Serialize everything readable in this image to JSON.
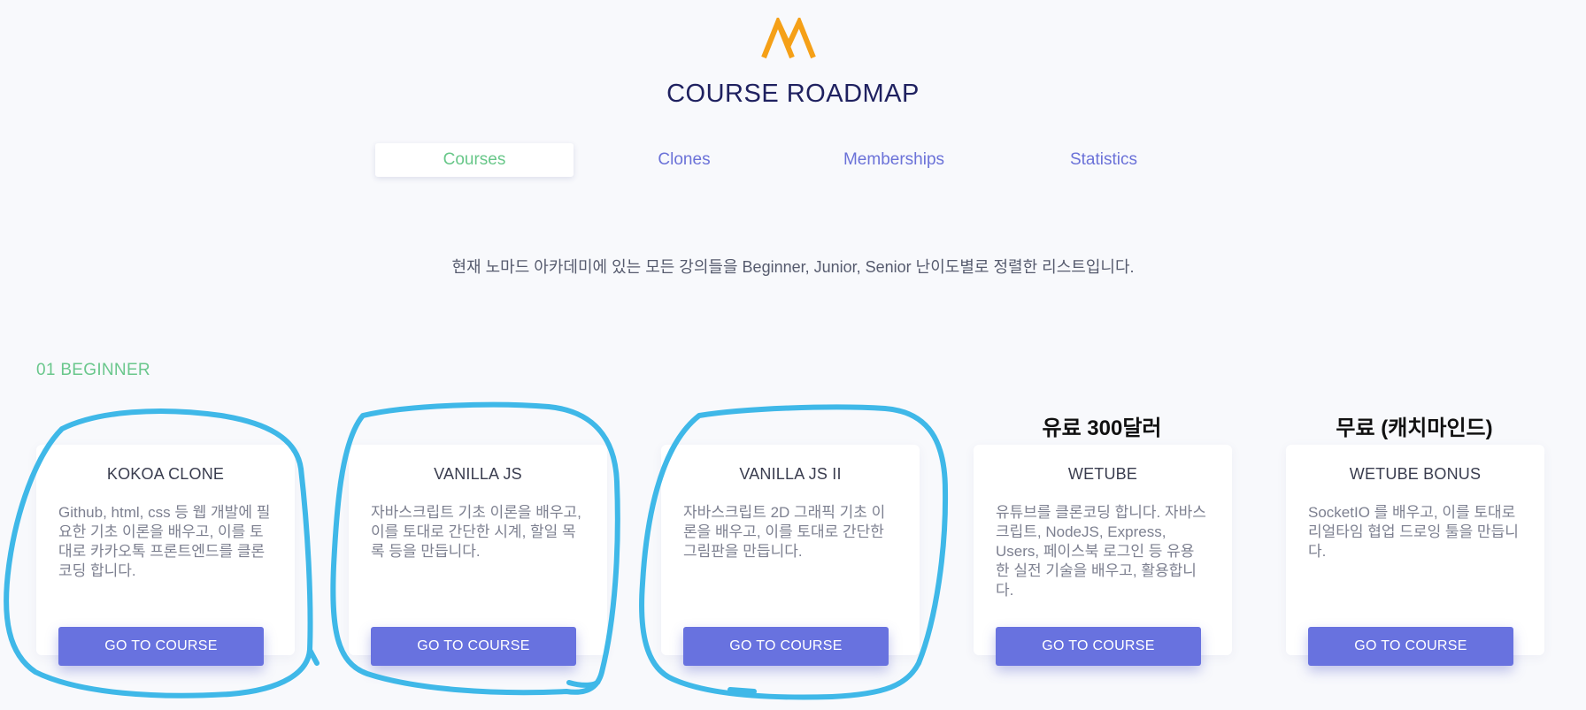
{
  "header": {
    "title": "COURSE ROADMAP",
    "logo_icon": "nomad-coders-logo-icon",
    "logo_color": "#f5a017"
  },
  "tabs": [
    {
      "label": "Courses",
      "active": true
    },
    {
      "label": "Clones",
      "active": false
    },
    {
      "label": "Memberships",
      "active": false
    },
    {
      "label": "Statistics",
      "active": false
    }
  ],
  "intro": "현재 노마드 아카데미에 있는 모든 강의들을 Beginner, Junior, Senior 난이도별로 정렬한 리스트입니다.",
  "section": {
    "label": "01 BEGINNER"
  },
  "annotations": {
    "wetube_note": "유료 300달러",
    "wetube_bonus_note": "무료 (캐치마인드)",
    "circle_color": "#3fb8e8"
  },
  "courses": [
    {
      "title": "KOKOA CLONE",
      "description": "Github, html, css 등 웹 개발에 필요한 기초 이론을 배우고, 이를 토대로 카카오톡 프론트엔드를 클론코딩 합니다.",
      "button": "GO TO COURSE"
    },
    {
      "title": "VANILLA JS",
      "description": "자바스크립트 기초 이론을 배우고, 이를 토대로 간단한 시계, 할일 목록 등을 만듭니다.",
      "button": "GO TO COURSE"
    },
    {
      "title": "VANILLA JS II",
      "description": "자바스크립트 2D 그래픽 기초 이론을 배우고, 이를 토대로 간단한 그림판을 만듭니다.",
      "button": "GO TO COURSE"
    },
    {
      "title": "WETUBE",
      "description": "유튜브를 클론코딩 합니다. 자바스크립트, NodeJS, Express, Users, 페이스북 로그인 등 유용한 실전 기술을 배우고, 활용합니다.",
      "button": "GO TO COURSE"
    },
    {
      "title": "WETUBE BONUS",
      "description": "SocketIO 를 배우고, 이를 토대로 리얼타임 협업 드로잉 툴을 만듭니다.",
      "button": "GO TO COURSE"
    }
  ],
  "colors": {
    "accent": "#6872df",
    "active_tab": "#68c789",
    "tab": "#6b72d8",
    "title": "#1f2160"
  }
}
